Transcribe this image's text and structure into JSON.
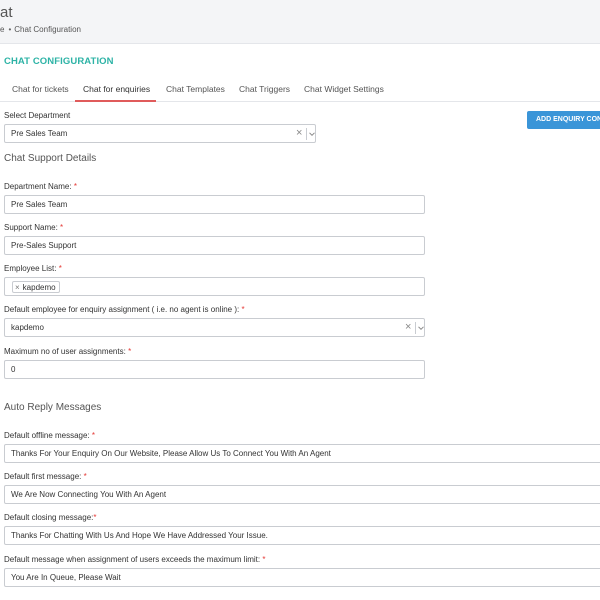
{
  "page": {
    "title": "at"
  },
  "breadcrumb": {
    "items": [
      "e",
      "Chat Configuration"
    ],
    "separator": "•"
  },
  "section_heading": "CHAT CONFIGURATION",
  "tabs": [
    {
      "label": "Chat for tickets",
      "active": false
    },
    {
      "label": "Chat for enquiries",
      "active": true
    },
    {
      "label": "Chat Templates",
      "active": false
    },
    {
      "label": "Chat Triggers",
      "active": false
    },
    {
      "label": "Chat Widget Settings",
      "active": false
    }
  ],
  "select_department": {
    "label": "Select Department",
    "value": "Pre Sales Team"
  },
  "add_enquiry_button": {
    "label": "ADD ENQUIRY CONF"
  },
  "chat_support_details": {
    "heading": "Chat Support Details",
    "department_name": {
      "label": "Department Name:",
      "value": "Pre Sales Team"
    },
    "support_name": {
      "label": "Support Name:",
      "value": "Pre-Sales Support"
    },
    "employee_list": {
      "label": "Employee List:",
      "tags": [
        "kapdemo"
      ]
    },
    "default_employee": {
      "label": "Default employee for enquiry assignment ( i.e. no agent is online ):",
      "value": "kapdemo"
    },
    "max_assignments": {
      "label": "Maximum no of user assignments:",
      "value": "0"
    }
  },
  "auto_reply": {
    "heading": "Auto Reply Messages",
    "offline": {
      "label": "Default offline message:",
      "value": "Thanks For Your Enquiry On Our Website, Please Allow Us To Connect You With An Agent"
    },
    "first": {
      "label": "Default first message:",
      "value": "We Are Now Connecting You With An Agent"
    },
    "closing": {
      "label": "Default closing message:",
      "value": "Thanks For Chatting With Us And Hope We Have Addressed Your Issue."
    },
    "queue": {
      "label": "Default message when assignment of users exceeds the maximum limit:",
      "value": "You Are In Queue, Please Wait"
    }
  },
  "required_marker": "*",
  "colors": {
    "accent": "#2db3a6",
    "tab_underline": "#e05b5b",
    "button": "#3a95d8",
    "required": "#e53935"
  }
}
